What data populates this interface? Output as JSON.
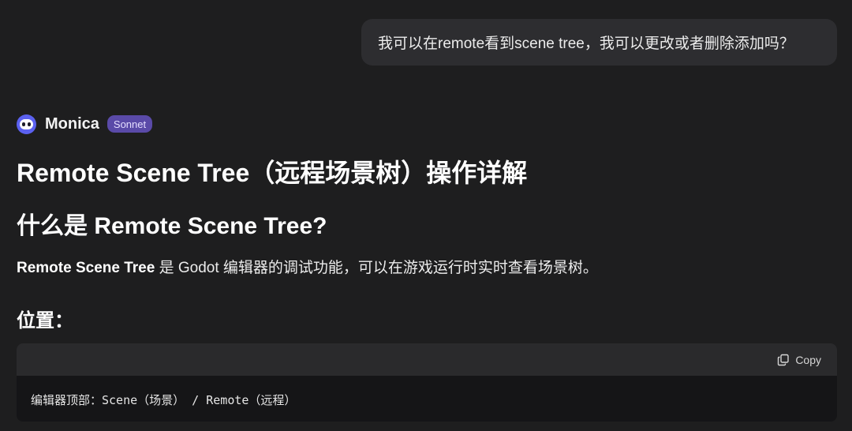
{
  "user_message": "我可以在remote看到scene tree，我可以更改或者删除添加吗？",
  "assistant": {
    "name": "Monica",
    "model_badge": "Sonnet"
  },
  "content": {
    "heading1": "Remote Scene Tree（远程场景树）操作详解",
    "heading2": "什么是 Remote Scene Tree?",
    "paragraph_bold": "Remote Scene Tree",
    "paragraph_rest": " 是 Godot 编辑器的调试功能，可以在游戏运行时实时查看场景树。",
    "heading3": "位置：",
    "code_block": {
      "copy_label": "Copy",
      "code": "编辑器顶部：Scene（场景） / Remote（远程）"
    }
  },
  "colors": {
    "background": "#1e1e1f",
    "user_bubble": "#2d2d30",
    "badge": "#5a4aa8",
    "avatar": "#5b61f0",
    "code_bg": "#151517",
    "code_toolbar": "#2a2a2c"
  }
}
